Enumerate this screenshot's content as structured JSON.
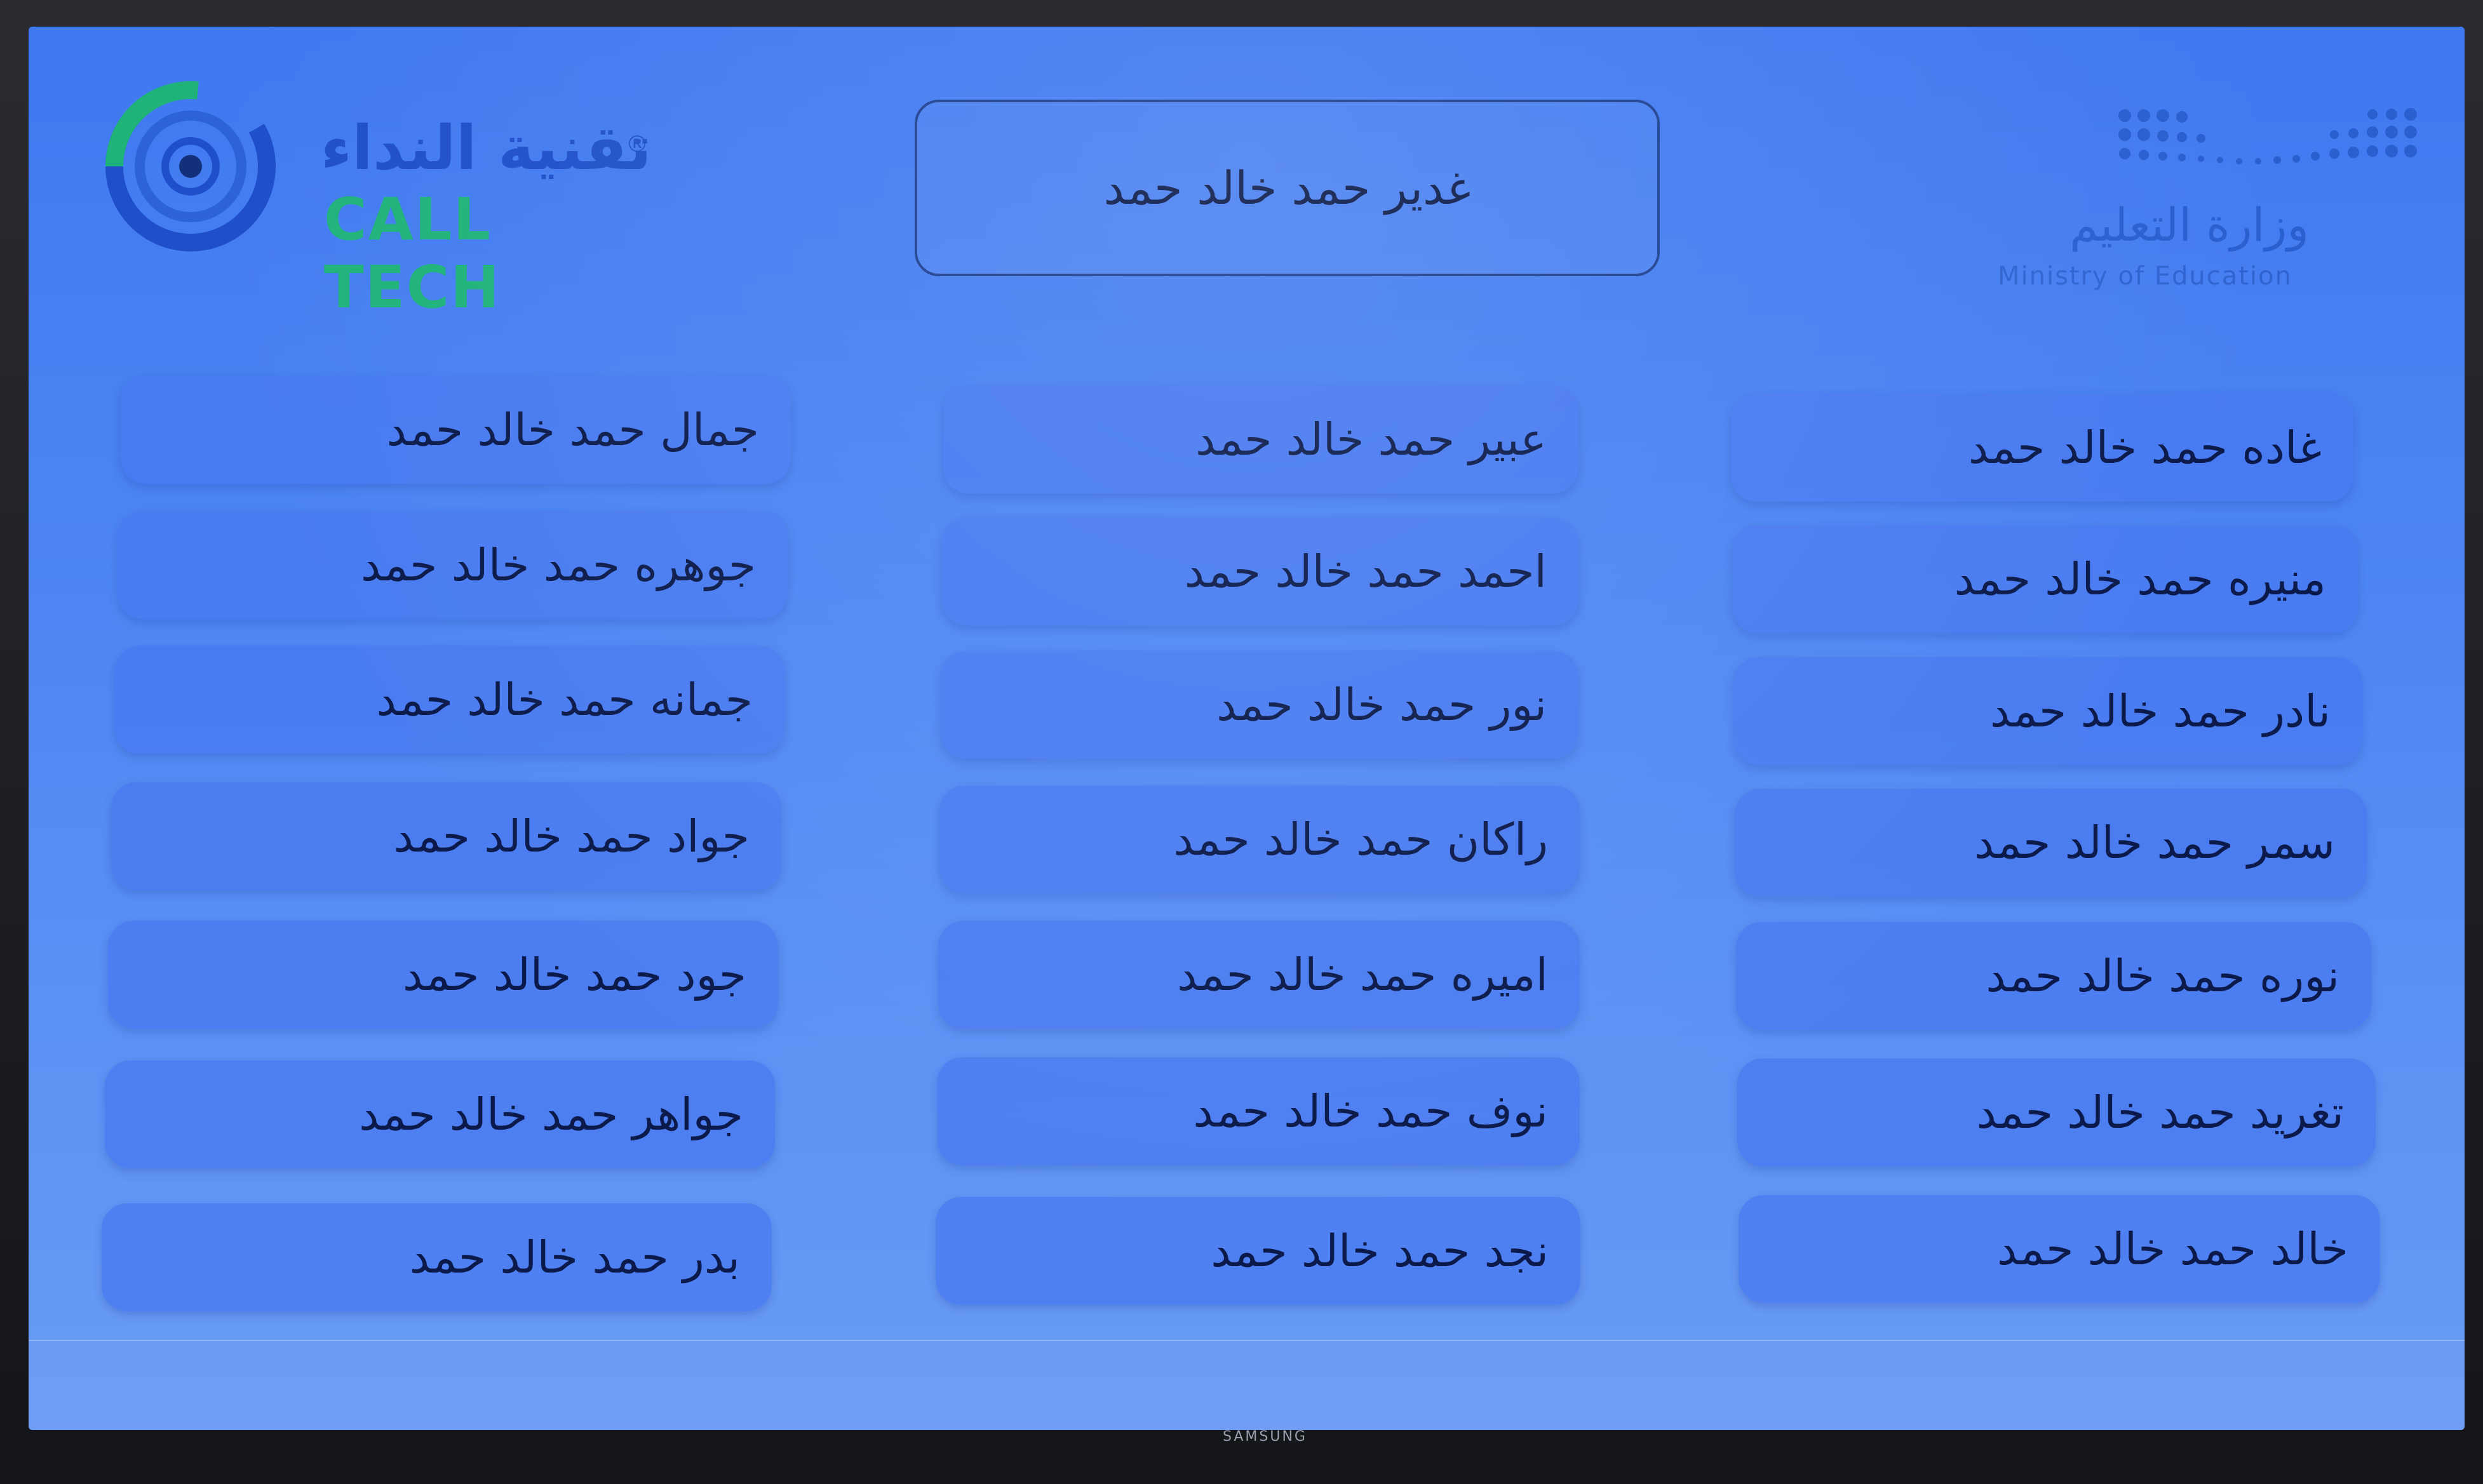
{
  "header": {
    "brand": {
      "name_ar": "تقنية النداء",
      "name_en": "CALL TECH",
      "reg": "®"
    },
    "ministry": {
      "name_ar": "وزارة التعليم",
      "name_en": "Ministry of Education"
    }
  },
  "current_caller": "غدير حمد خالد حمد",
  "columns": {
    "left": [
      "جمال حمد خالد حمد",
      "جوهره حمد خالد حمد",
      "جمانه حمد خالد حمد",
      "جواد حمد خالد حمد",
      "جود حمد خالد حمد",
      "جواهر حمد خالد حمد",
      "بدر حمد خالد حمد"
    ],
    "middle": [
      "عبير حمد خالد حمد",
      "احمد حمد خالد حمد",
      "نور حمد خالد حمد",
      "راكان حمد خالد حمد",
      "اميره حمد خالد حمد",
      "نوف حمد خالد حمد",
      "نجد حمد خالد حمد"
    ],
    "right": [
      "غاده حمد خالد حمد",
      "منيره حمد خالد حمد",
      "نادر حمد خالد حمد",
      "سمر حمد خالد حمد",
      "نوره حمد خالد حمد",
      "تغريد حمد خالد حمد",
      "خالد حمد خالد حمد"
    ]
  },
  "tv_brand": "SAMSUNG",
  "colors": {
    "screen_bg": "#4a82f2",
    "card_bg": "#4878f0",
    "text": "#0b1a4a",
    "brand_blue": "#1f4fc9",
    "brand_green": "#1fb37a"
  }
}
